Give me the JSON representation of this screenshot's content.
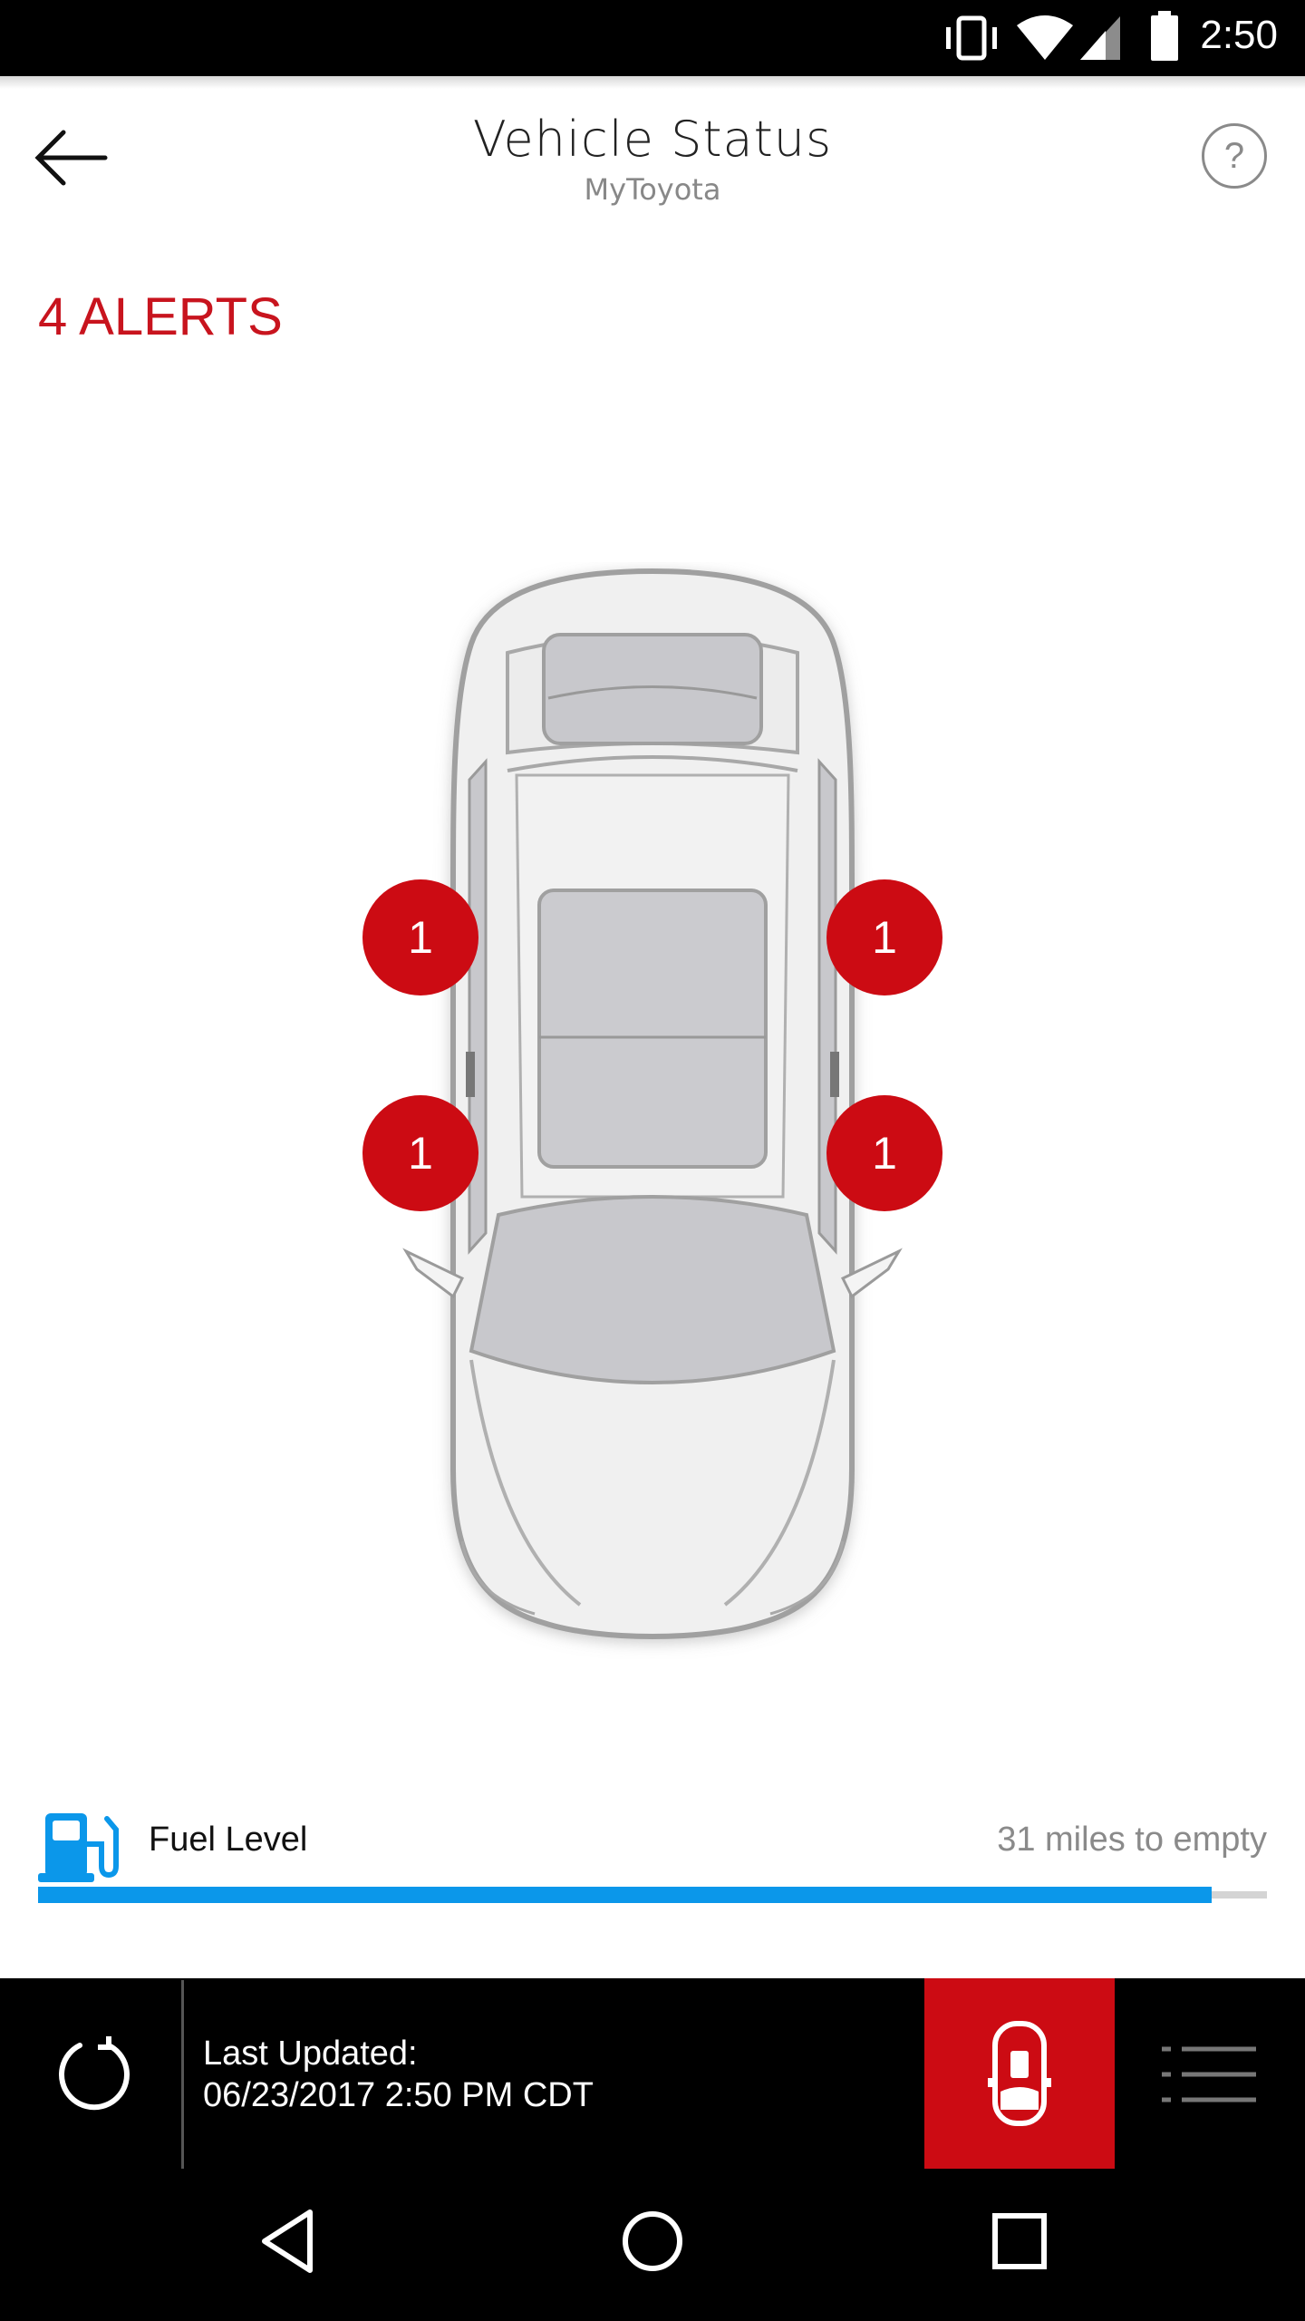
{
  "status_bar": {
    "time": "2:50"
  },
  "header": {
    "title": "Vehicle Status",
    "subtitle": "MyToyota",
    "help_label": "?"
  },
  "alerts": {
    "label": "4 ALERTS"
  },
  "vehicle": {
    "door_alerts": {
      "front_left": "1",
      "front_right": "1",
      "rear_left": "1",
      "rear_right": "1"
    }
  },
  "fuel": {
    "label": "Fuel Level",
    "range_text": "31 miles to empty",
    "level": 0.955,
    "color": "#0b97ea"
  },
  "bottom_bar": {
    "updated_label": "Last Updated:",
    "updated_value": "06/23/2017 2:50 PM CDT"
  },
  "colors": {
    "alert_red": "#cc0b13",
    "fuel_blue": "#0b97ea"
  }
}
